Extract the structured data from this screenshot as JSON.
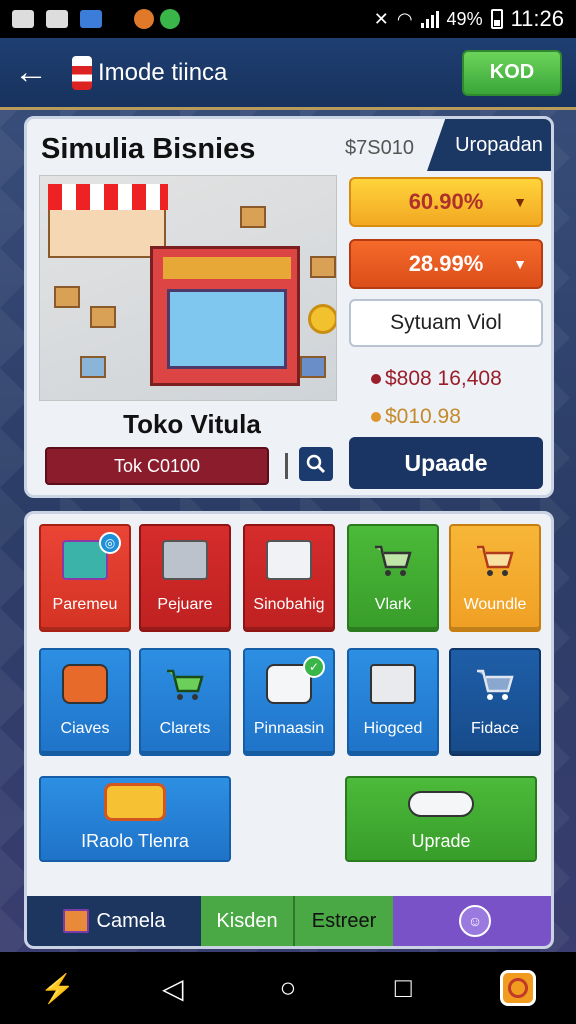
{
  "status": {
    "battery": "49%",
    "time": "11:26"
  },
  "appbar": {
    "title": "Imode tiinca",
    "action_label": "KOD"
  },
  "business": {
    "title": "Simulia Bisnies",
    "price": "$7S010",
    "upgrade_tab": "Uropadan",
    "store_name": "Toko Vitula",
    "input_value": "Tok C0100",
    "dropdown_1": "60.90%",
    "dropdown_2": "28.99%",
    "field_value": "Sytuam Viol",
    "stat_1": "$808 16,408",
    "stat_2": "$010.98",
    "upgrade_button": "Upaade"
  },
  "tiles": [
    {
      "label": "Paremeu",
      "icon": "box-icon"
    },
    {
      "label": "Pejuare",
      "icon": "crate-icon"
    },
    {
      "label": "Sinobahig",
      "icon": "package-icon"
    },
    {
      "label": "Vlark",
      "icon": "cart-icon"
    },
    {
      "label": "Woundle",
      "icon": "cart-icon"
    },
    {
      "label": "Ciaves",
      "icon": "truck-icon"
    },
    {
      "label": "Clarets",
      "icon": "cart-icon"
    },
    {
      "label": "Pinnaasin",
      "icon": "van-icon"
    },
    {
      "label": "Hiogced",
      "icon": "package-icon"
    },
    {
      "label": "Fidace",
      "icon": "cart-icon"
    }
  ],
  "wide_tiles": {
    "left_label": "IRaolo Tlenra",
    "right_label": "Uprade"
  },
  "tabbar": {
    "tab_1": "Camela",
    "tab_2": "Kisden",
    "tab_3": "Estreer"
  },
  "colors": {
    "primary_navy": "#1a3564",
    "accent_green": "#4cba3a",
    "accent_orange": "#f56a2a",
    "accent_yellow": "#ffd43a",
    "accent_purple": "#7a52c8"
  }
}
